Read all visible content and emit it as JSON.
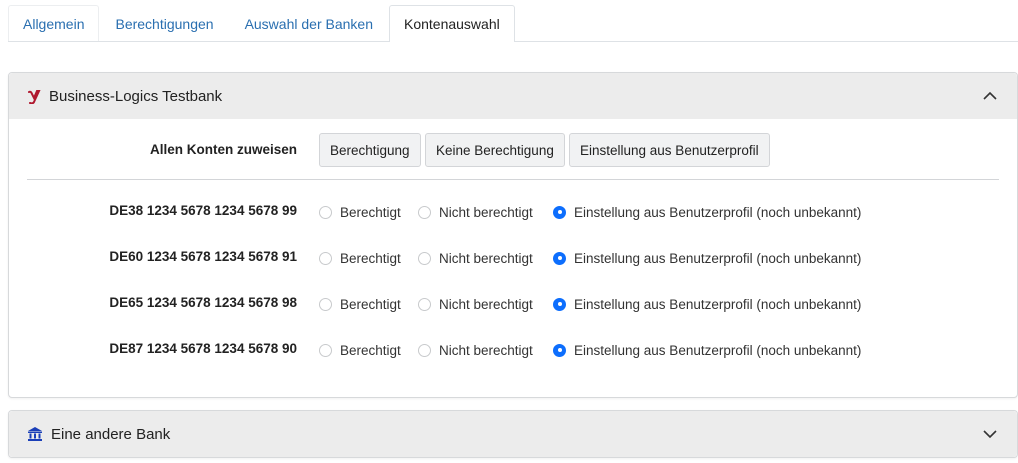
{
  "tabs": [
    {
      "label": "Allgemein"
    },
    {
      "label": "Berechtigungen"
    },
    {
      "label": "Auswahl der Banken"
    },
    {
      "label": "Kontenauswahl"
    }
  ],
  "active_tab": "Kontenauswahl",
  "bank1": {
    "title": "Business-Logics Testbank",
    "icon": "bank-logo-icon",
    "expanded": true,
    "assign_label": "Allen Konten zuweisen",
    "buttons": {
      "grant": "Berechtigung",
      "deny": "Keine Berechtigung",
      "profile": "Einstellung aus Benutzerprofil"
    },
    "options": {
      "granted": "Berechtigt",
      "not_granted": "Nicht berechtigt",
      "profile": "Einstellung aus Benutzerprofil (noch unbekannt)"
    },
    "accounts": [
      {
        "iban": "DE38 1234 5678 1234 5678 99",
        "selected": "profile"
      },
      {
        "iban": "DE60 1234 5678 1234 5678 91",
        "selected": "profile"
      },
      {
        "iban": "DE65 1234 5678 1234 5678 98",
        "selected": "profile"
      },
      {
        "iban": "DE87 1234 5678 1234 5678 90",
        "selected": "profile"
      }
    ]
  },
  "bank2": {
    "title": "Eine andere Bank",
    "icon": "bank-building-icon",
    "expanded": false
  },
  "colors": {
    "link": "#2a6fb0",
    "radio_checked": "#0d6efd",
    "header_bg": "#ececec",
    "brand_icon": "#b0182e",
    "bank_icon": "#1a3fb8"
  }
}
